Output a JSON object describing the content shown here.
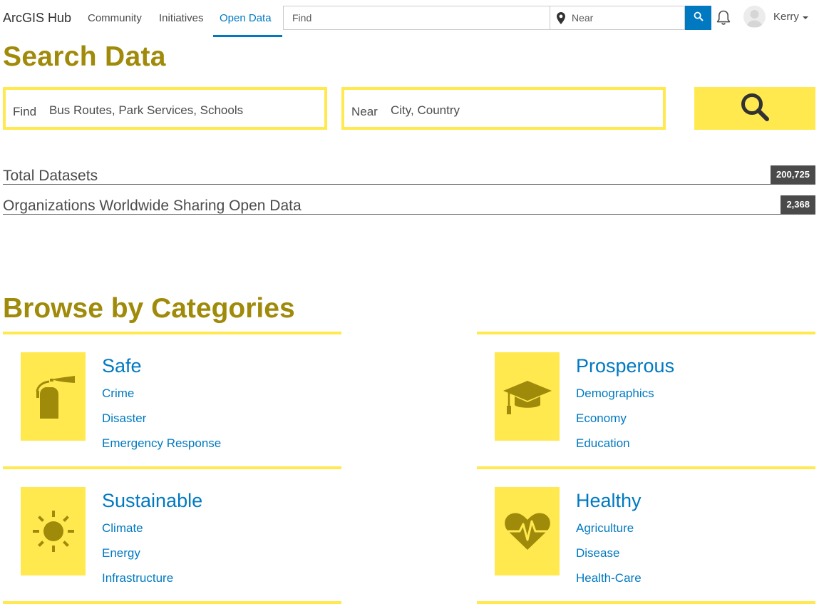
{
  "nav": {
    "brand": "ArcGIS Hub",
    "links": [
      "Community",
      "Initiatives",
      "Open Data"
    ],
    "find_placeholder": "Find",
    "near_placeholder": "Near",
    "username": "Kerry",
    "accent_color": "#0079c1"
  },
  "search": {
    "title": "Search Data",
    "find_label": "Find",
    "find_placeholder": "Bus Routes, Park Services, Schools",
    "near_label": "Near",
    "near_placeholder": "City, Country",
    "button_icon": "search-icon",
    "accent_color": "#ffe94f"
  },
  "stats": [
    {
      "label": "Total Datasets",
      "value": "200,725"
    },
    {
      "label": "Organizations Worldwide Sharing Open Data",
      "value": "2,368"
    }
  ],
  "categories": {
    "title": "Browse by Categories",
    "title_color": "#a08a0a",
    "items": [
      {
        "title": "Safe",
        "icon": "fire-extinguisher-icon",
        "links": [
          "Crime",
          "Disaster",
          "Emergency Response"
        ]
      },
      {
        "title": "Prosperous",
        "icon": "graduation-cap-icon",
        "links": [
          "Demographics",
          "Economy",
          "Education"
        ]
      },
      {
        "title": "Sustainable",
        "icon": "sun-icon",
        "links": [
          "Climate",
          "Energy",
          "Infrastructure"
        ]
      },
      {
        "title": "Healthy",
        "icon": "heart-pulse-icon",
        "links": [
          "Agriculture",
          "Disease",
          "Health-Care"
        ]
      }
    ]
  }
}
